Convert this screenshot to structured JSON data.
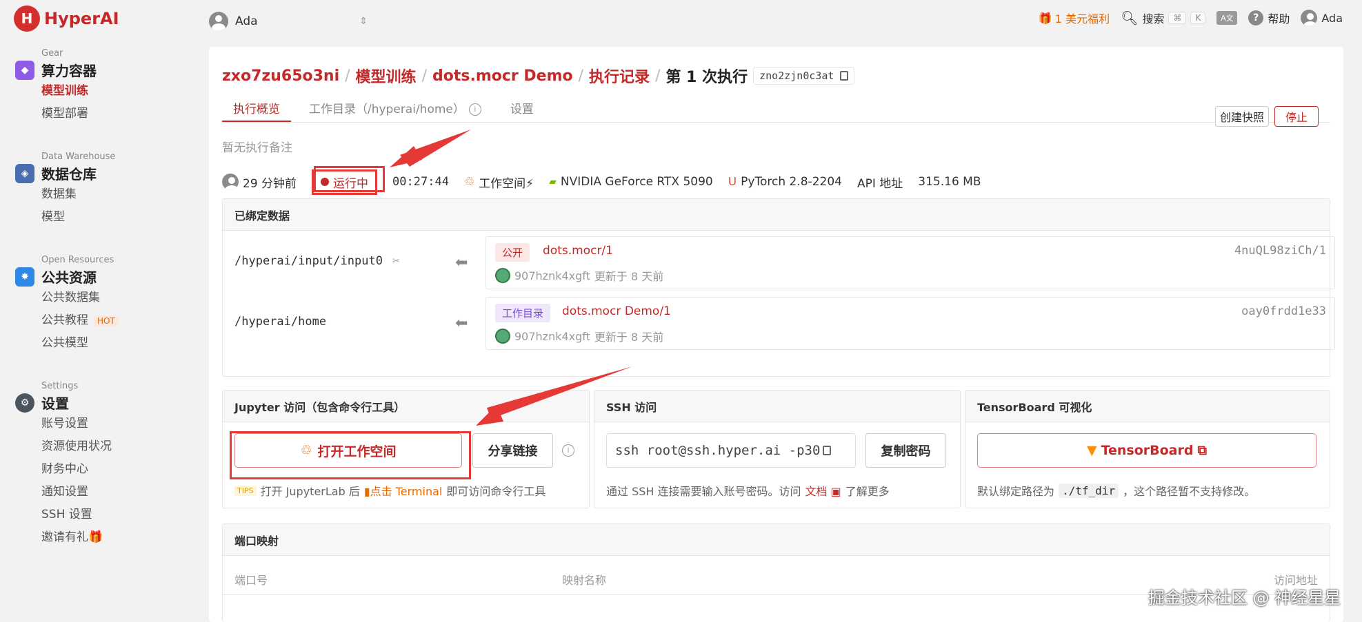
{
  "app": {
    "name": "HyperAI",
    "logo_glyph": "H"
  },
  "topbar": {
    "user": "Ada",
    "promo": "1 美元福利",
    "search": "搜索",
    "kbd_cmd": "⌘",
    "kbd_k": "K",
    "lang_icon_text": "A文",
    "help": "帮助",
    "account": "Ada"
  },
  "sidebar": {
    "sections": [
      {
        "sub": "Gear",
        "title": "算力容器",
        "items": [
          "模型训练",
          "模型部署"
        ]
      },
      {
        "sub": "Data Warehouse",
        "title": "数据仓库",
        "items": [
          "数据集",
          "模型"
        ]
      },
      {
        "sub": "Open Resources",
        "title": "公共资源",
        "items": [
          "公共数据集",
          "公共教程",
          "公共模型"
        ],
        "hot_badge": "HOT"
      },
      {
        "sub": "Settings",
        "title": "设置",
        "items": [
          "账号设置",
          "资源使用状况",
          "财务中心",
          "通知设置",
          "SSH 设置",
          "邀请有礼🎁"
        ]
      }
    ]
  },
  "breadcrumb": {
    "items": [
      "zxo7zu65o3ni",
      "模型训练",
      "dots.mocr Demo",
      "执行记录"
    ],
    "current": "第 1 次执行",
    "id": "zno2zjn0c3at",
    "sep": "/"
  },
  "tabs": [
    "执行概览",
    "工作目录（/hyperai/home）",
    "设置"
  ],
  "note": "暂无执行备注",
  "actions": {
    "snapshot": "创建快照",
    "stop": "停止"
  },
  "status": {
    "time_ago": "29 分钟前",
    "state": "运行中",
    "elapsed": "00:27:44",
    "workspace": "工作空间⚡",
    "gpu": "NVIDIA GeForce RTX 5090",
    "framework": "PyTorch 2.8-2204",
    "api": "API 地址",
    "size": "315.16 MB"
  },
  "bound": {
    "title": "已绑定数据",
    "rows": [
      {
        "path": "/hyperai/input/input0",
        "tag": "公开",
        "name": "dots.mocr/1",
        "hash": "4nuQL98ziCh/1",
        "user": "907hznk4xgft",
        "updated": "更新于 8 天前"
      },
      {
        "path": "/hyperai/home",
        "tag": "工作目录",
        "name": "dots.mocr Demo/1",
        "hash": "oay0frdd1e33",
        "user": "907hznk4xgft",
        "updated": "更新于 8 天前"
      }
    ]
  },
  "jupyter": {
    "title": "Jupyter 访问（包含命令行工具）",
    "open": "打开工作空间",
    "share": "分享链接",
    "tips_tag": "TIPS",
    "tips_a": "打开 JupyterLab 后",
    "tips_b": "点击 Terminal",
    "tips_c": "即可访问命令行工具"
  },
  "ssh": {
    "title": "SSH 访问",
    "command": "ssh root@ssh.hyper.ai -p30",
    "copy_pwd": "复制密码",
    "desc_a": "通过 SSH 连接需要输入账号密码。访问",
    "desc_link": "文档",
    "desc_b": "了解更多"
  },
  "tensorboard": {
    "title": "TensorBoard 可视化",
    "button": "TensorBoard",
    "desc_a": "默认绑定路径为",
    "path": "./tf_dir",
    "desc_b": "，这个路径暂不支持修改。"
  },
  "ports": {
    "title": "端口映射",
    "cols": [
      "端口号",
      "映射名称",
      "访问地址"
    ]
  },
  "watermark": "掘金技术社区 @ 神经星星",
  "colors": {
    "accent": "#c62828",
    "promo": "#e56a00",
    "annotation": "#e53935"
  }
}
